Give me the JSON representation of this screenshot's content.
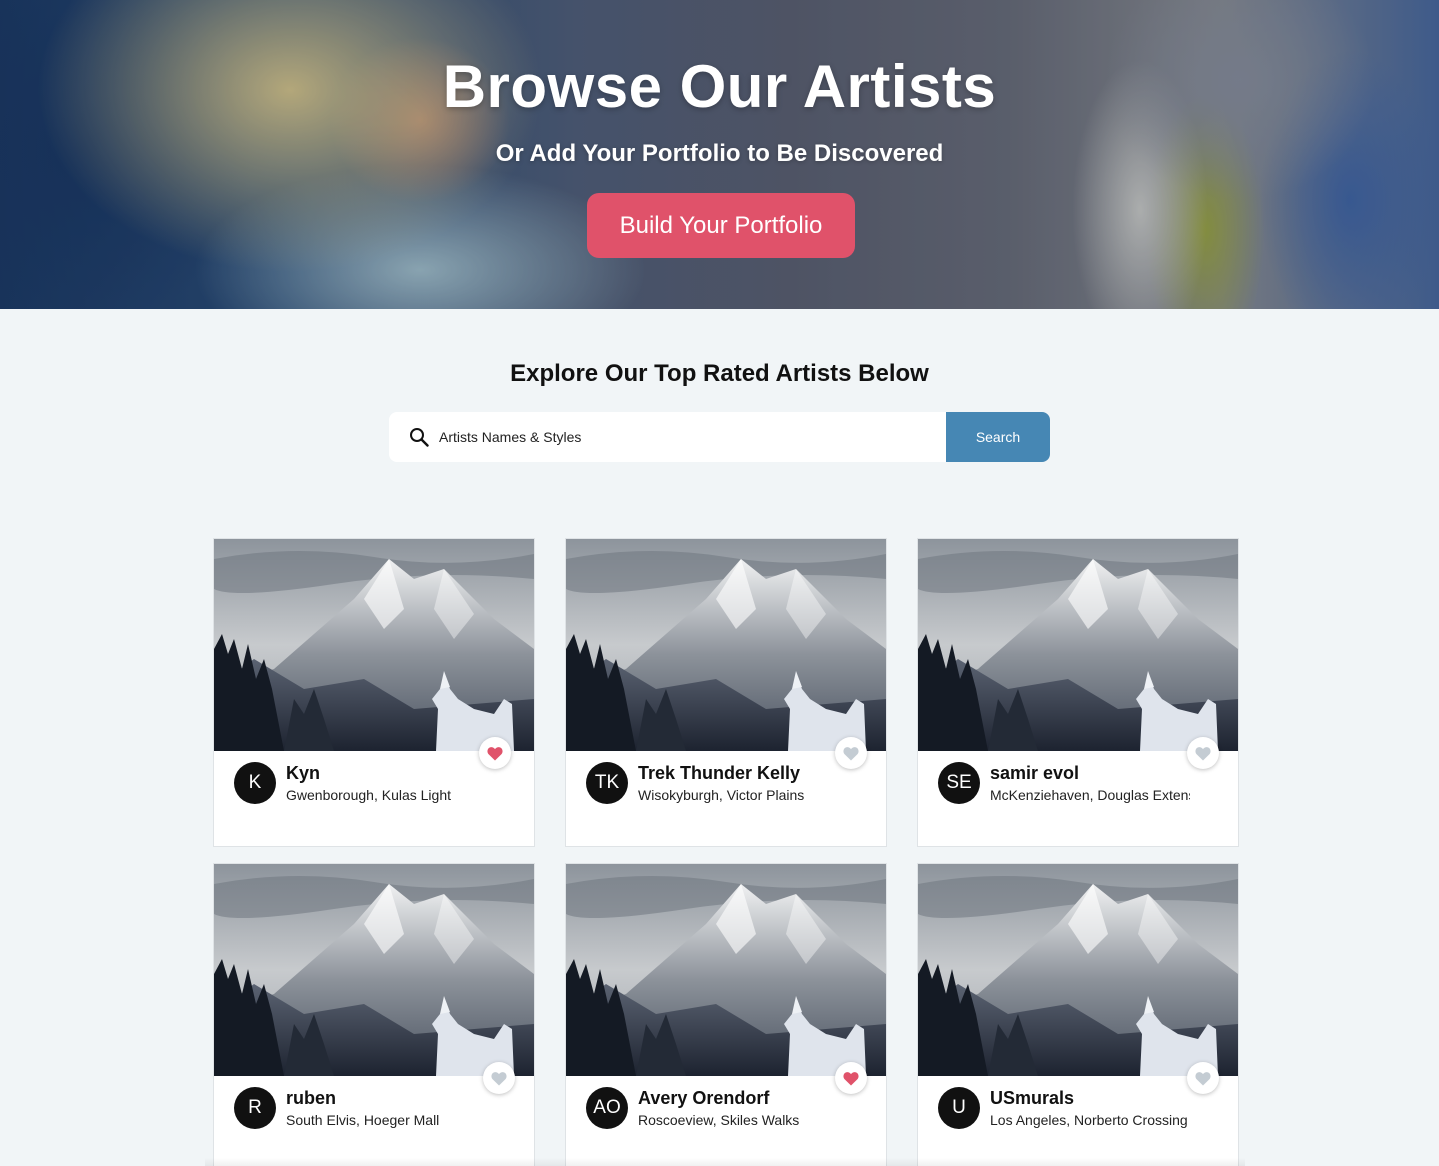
{
  "hero": {
    "title": "Browse Our Artists",
    "subtitle": "Or Add Your Portfolio to Be Discovered",
    "cta_label": "Build Your Portfolio"
  },
  "explore": {
    "title": "Explore Our Top Rated Artists Below",
    "search_placeholder": "Artists Names & Styles",
    "search_button": "Search"
  },
  "colors": {
    "accent_pink": "#e0526a",
    "search_blue": "#4687b4",
    "favorite_active": "#e0526a",
    "favorite_inactive": "#c4ccd3"
  },
  "artists": [
    {
      "initials": "K",
      "name": "Kyn",
      "location": "Gwenborough, Kulas Light",
      "favorited": true
    },
    {
      "initials": "TK",
      "name": "Trek Thunder Kelly",
      "location": "Wisokyburgh, Victor Plains",
      "favorited": false
    },
    {
      "initials": "SE",
      "name": "samir evol",
      "location": "McKenziehaven, Douglas Extension",
      "favorited": false
    },
    {
      "initials": "R",
      "name": "ruben",
      "location": "South Elvis, Hoeger Mall",
      "favorited": false
    },
    {
      "initials": "AO",
      "name": "Avery Orendorf",
      "location": "Roscoeview, Skiles Walks",
      "favorited": true
    },
    {
      "initials": "U",
      "name": "USmurals",
      "location": "Los Angeles, Norberto Crossing",
      "favorited": false
    }
  ]
}
